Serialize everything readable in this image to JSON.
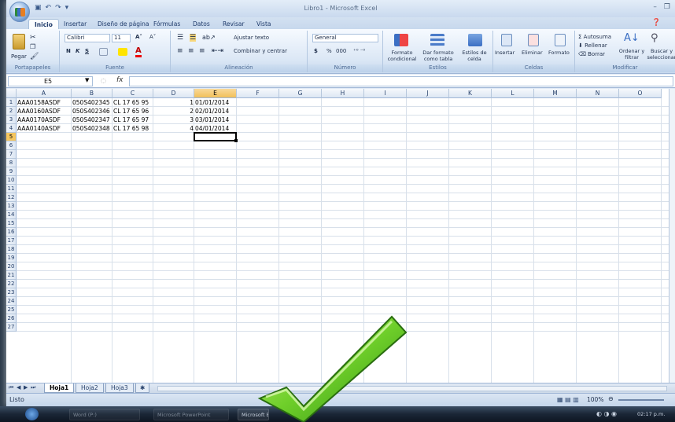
{
  "window": {
    "title": "Libro1 - Microsoft Excel"
  },
  "tabs": [
    "Inicio",
    "Insertar",
    "Diseño de página",
    "Fórmulas",
    "Datos",
    "Revisar",
    "Vista"
  ],
  "ribbon": {
    "clipboard": {
      "label": "Portapapeles",
      "paste": "Pegar"
    },
    "font": {
      "label": "Fuente",
      "name": "Calibri",
      "size": "11",
      "bold": "N",
      "italic": "K",
      "underline": "S"
    },
    "alignment": {
      "label": "Alineación",
      "wrap": "Ajustar texto",
      "merge": "Combinar y centrar"
    },
    "number": {
      "label": "Número",
      "format": "General",
      "currency": "$",
      "percent": "%",
      "thousands": "000"
    },
    "styles": {
      "label": "Estilos",
      "conditional": "Formato condicional",
      "table": "Dar formato como tabla",
      "cell": "Estilos de celda"
    },
    "cells": {
      "label": "Celdas",
      "insert": "Insertar",
      "delete": "Eliminar",
      "format": "Formato"
    },
    "editing": {
      "label": "Modificar",
      "autosum": "Autosuma",
      "fill": "Rellenar",
      "clear": "Borrar",
      "sort": "Ordenar y filtrar",
      "find": "Buscar y seleccionar"
    }
  },
  "formula_bar": {
    "name_box": "E5",
    "fx": "fx",
    "content": ""
  },
  "columns": [
    "A",
    "B",
    "C",
    "D",
    "E",
    "F",
    "G",
    "H",
    "I",
    "J",
    "K",
    "L",
    "M",
    "N",
    "O"
  ],
  "rows": [
    {
      "n": "1",
      "a": "AAA0158ASDF",
      "b": "050S402345",
      "c": "CL 17 65 95",
      "d": "1",
      "e": "01/01/2014"
    },
    {
      "n": "2",
      "a": "AAA0160ASDF",
      "b": "050S402346",
      "c": "CL 17 65 96",
      "d": "2",
      "e": "02/01/2014"
    },
    {
      "n": "3",
      "a": "AAA0170ASDF",
      "b": "050S402347",
      "c": "CL 17 65 97",
      "d": "3",
      "e": "03/01/2014"
    },
    {
      "n": "4",
      "a": "AAA0140ASDF",
      "b": "050S402348",
      "c": "CL 17 65 98",
      "d": "4",
      "e": "04/01/2014"
    }
  ],
  "sheets": [
    "Hoja1",
    "Hoja2",
    "Hoja3"
  ],
  "status": {
    "ready": "Listo",
    "zoom": "100%"
  },
  "taskbar": {
    "item1": "Word (P:)",
    "item2": "Microsoft PowerPoint",
    "item3": "Microsoft Excel",
    "clock": "02:17 p.m."
  }
}
